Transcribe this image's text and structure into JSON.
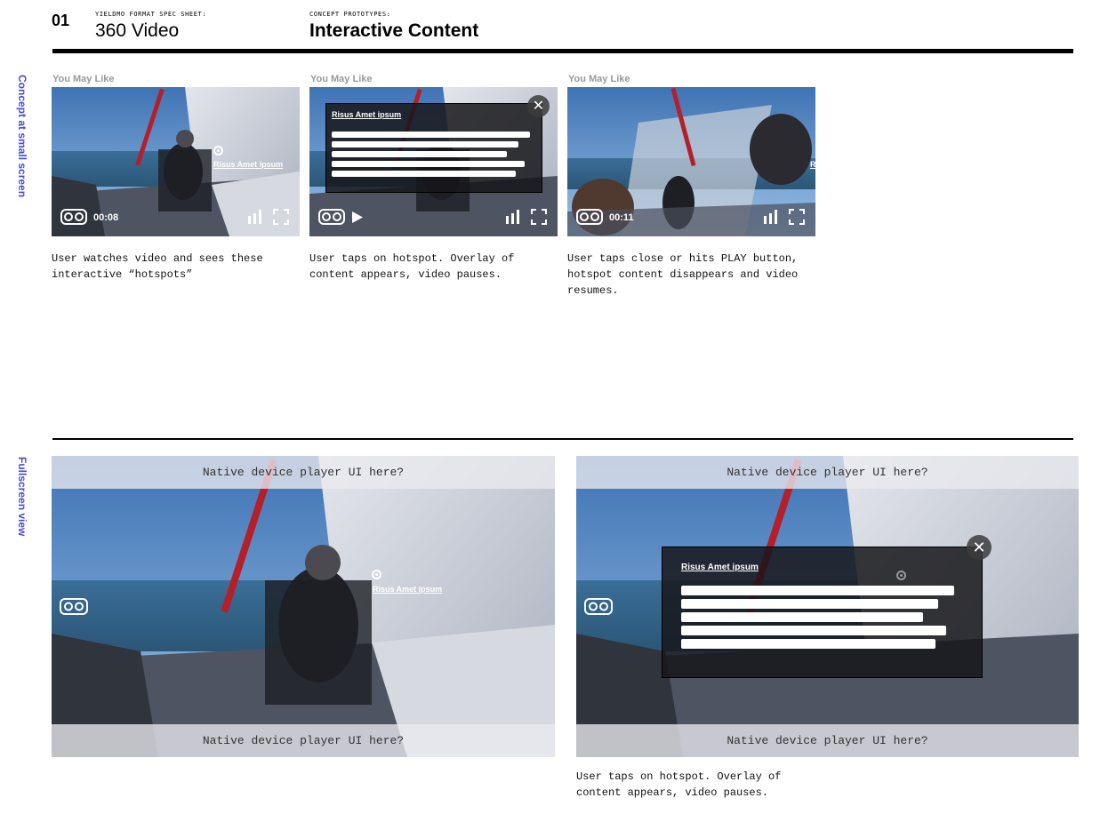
{
  "header": {
    "number": "01",
    "spec_label": "YIELDMO FORMAT SPEC SHEET:",
    "spec_title": "360 Video",
    "concept_label": "CONCEPT PROTOTYPES:",
    "concept_title": "Interactive Content"
  },
  "sections": {
    "small_screen_label": "Concept at small screen",
    "fullscreen_label": "Fullscreen view"
  },
  "small_screen": {
    "frames": [
      {
        "heading": "You May Like",
        "time": "00:08",
        "hotspot_label": "Risus Amet ipsum",
        "caption": "User watches video and sees these interactive “hotspots”"
      },
      {
        "heading": "You May Like",
        "overlay_title": "Risus Amet ipsum",
        "caption": "User taps on hotspot. Overlay of content appears, video pauses."
      },
      {
        "heading": "You May Like",
        "time": "00:11",
        "hotspot_label": "R",
        "caption": "User taps close or hits PLAY button, hotspot content disappears and video resumes."
      }
    ]
  },
  "fullscreen": {
    "native_ui_text": "Native device player UI here?",
    "frame1": {
      "hotspot_label": "Risus Amet ipsum"
    },
    "frame2": {
      "overlay_title": "Risus Amet ipsum",
      "caption": "User taps on hotspot. Overlay of content appears, video pauses."
    }
  },
  "icons": {
    "vr": "vr-goggles-icon",
    "play": "play-icon",
    "volume": "volume-bars-icon",
    "fullscreen": "fullscreen-icon",
    "close": "close-icon",
    "hotspot": "hotspot-target-icon"
  },
  "colors": {
    "accent": "#4a4ad6",
    "caption_heading": "#9a9a9a"
  }
}
